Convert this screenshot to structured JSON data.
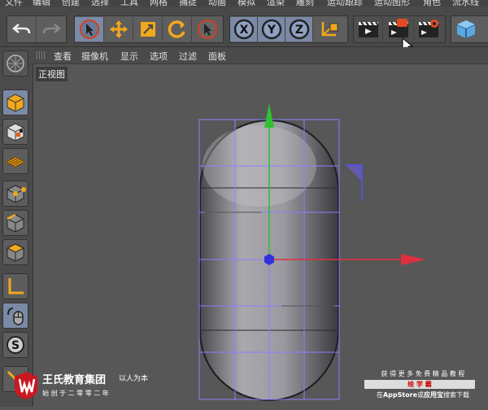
{
  "menu": {
    "items": [
      "文件",
      "编辑",
      "创建",
      "选择",
      "工具",
      "网格",
      "捕捉",
      "动画",
      "模拟",
      "渲染",
      "雕刻",
      "运动跟踪",
      "运动图形",
      "角色",
      "流水线"
    ]
  },
  "toolbar": {
    "undo_icon": "undo-icon",
    "redo_icon": "redo-icon",
    "tools": [
      "select-arrow-icon",
      "move-icon",
      "scale-icon",
      "rotate-icon",
      "live-select-icon"
    ],
    "axes": [
      "X",
      "Y",
      "Z"
    ],
    "coordinate_icon": "coordinate-system-icon",
    "render_icons": [
      "render-view-icon",
      "render-picture-viewer-icon",
      "render-settings-icon"
    ],
    "cube_icon": "cube-primitive-icon"
  },
  "viewport_menu": {
    "items": [
      "查看",
      "摄像机",
      "显示",
      "选项",
      "过滤",
      "面板"
    ]
  },
  "viewport": {
    "view_name": "正视图",
    "object": "capsule",
    "axis_colors": {
      "x": "#e03040",
      "y": "#30c030",
      "z": "#3030e0"
    },
    "selection_color": "#8a80ff"
  },
  "left_palette": {
    "icons": [
      "make-editable-icon",
      "model-mode-icon",
      "texture-mode-icon",
      "workplane-icon",
      "points-mode-icon",
      "edges-mode-icon",
      "polygons-mode-icon",
      "axis-mode-icon",
      "tweak-mode-icon",
      "snap-icon",
      "soft-selection-icon"
    ]
  },
  "watermark_left": {
    "brand": "王氏教育集团",
    "slogan": "以人为本",
    "sub": "始 创 于 二 零 零 二 年"
  },
  "watermark_right": {
    "line1": "获 得 更 多 免 费 精 品 教 程",
    "line2": "绘 学 霸",
    "line3_prefix": "在",
    "line3_store": "AppStore",
    "line3_mid": "或",
    "line3_app": "应用宝",
    "line3_suffix": "搜索下载"
  }
}
